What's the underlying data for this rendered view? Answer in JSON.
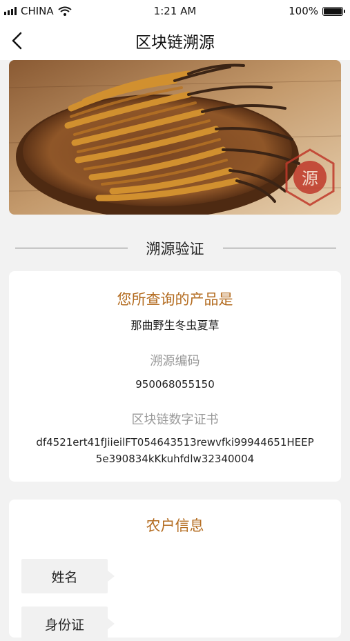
{
  "status_bar": {
    "carrier": "CHINA",
    "time": "1:21 AM",
    "battery": "100%"
  },
  "header": {
    "title": "区块链溯源",
    "back_icon": "chevron-left-icon"
  },
  "hero": {
    "seal_text": "源"
  },
  "section": {
    "title": "溯源验证"
  },
  "product": {
    "title": "您所查询的产品是",
    "name": "那曲野生冬虫夏草",
    "code_label": "溯源编码",
    "code": "950068055150",
    "cert_label": "区块链数字证书",
    "cert_line1": "df4521ert41fJiieilFT054643513rewvfki99944651HEEP",
    "cert_line2": "5e390834kKkuhfdlw32340004"
  },
  "farmer": {
    "title": "农户信息",
    "fields": [
      {
        "label": "姓名"
      },
      {
        "label": "身份证"
      }
    ]
  },
  "colors": {
    "accent": "#b36b1f",
    "seal": "#c0392b"
  }
}
